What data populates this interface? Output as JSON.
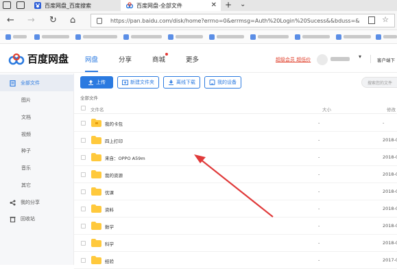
{
  "browser": {
    "tabs": [
      {
        "title": "百度网盘_百度搜索",
        "active": false
      },
      {
        "title": "百度网盘-全部文件",
        "active": true
      }
    ],
    "new_tab_symbol": "+",
    "tab_close_symbol": "✕",
    "address_url": "https://pan.baidu.com/disk/home?errno=0&errmsg=Auth%20Login%20Sucess&&bduss=&",
    "nav_icons": [
      "back-arrow-icon",
      "forward-arrow-icon",
      "refresh-icon",
      "home-icon",
      "lock-icon",
      "reader-icon",
      "star-icon"
    ]
  },
  "header": {
    "brand": "百度网盘",
    "nav": [
      {
        "label": "网盘",
        "active": true
      },
      {
        "label": "分享",
        "active": false
      },
      {
        "label": "商城",
        "active": false,
        "badge_dot": true
      },
      {
        "label": "更多",
        "active": false
      }
    ],
    "vip_link": "超级会员 超低价",
    "client_download": "客户端下",
    "accent_color": "#2b7ae0",
    "vip_color": "#e0402c"
  },
  "sidebar": {
    "items": [
      {
        "label": "全部文件",
        "active": true,
        "icon": "file-list-icon"
      },
      {
        "label": "图片",
        "active": false
      },
      {
        "label": "文档",
        "active": false
      },
      {
        "label": "视频",
        "active": false
      },
      {
        "label": "种子",
        "active": false
      },
      {
        "label": "音乐",
        "active": false
      },
      {
        "label": "其它",
        "active": false
      },
      {
        "label": "我的分享",
        "active": false,
        "icon": "share-icon"
      },
      {
        "label": "回收站",
        "active": false,
        "icon": "trash-icon"
      }
    ]
  },
  "toolbar": {
    "upload": "上传",
    "new_folder": "新建文件夹",
    "offline_download": "离线下载",
    "my_devices": "我的设备"
  },
  "search": {
    "placeholder": "搜索您的文件"
  },
  "breadcrumb": "全部文件",
  "table": {
    "headers": {
      "name": "文件名",
      "size": "大小",
      "modified": "修改"
    },
    "rows": [
      {
        "name": "我的卡包",
        "size": "-",
        "date": "-",
        "special": true
      },
      {
        "name": "四上打印",
        "size": "-",
        "date": "2018-0"
      },
      {
        "name": "来自：OPPO A59m",
        "size": "-",
        "date": "2018-0"
      },
      {
        "name": "我的资源",
        "size": "-",
        "date": "2018-0"
      },
      {
        "name": "优课",
        "size": "-",
        "date": "2018-0"
      },
      {
        "name": "资料",
        "size": "-",
        "date": "2018-0"
      },
      {
        "name": "数学",
        "size": "-",
        "date": "2018-0"
      },
      {
        "name": "科学",
        "size": "-",
        "date": "2018-0"
      },
      {
        "name": "经验",
        "size": "-",
        "date": "2017-0"
      }
    ]
  },
  "annotation": {
    "color": "#e03a3a"
  }
}
